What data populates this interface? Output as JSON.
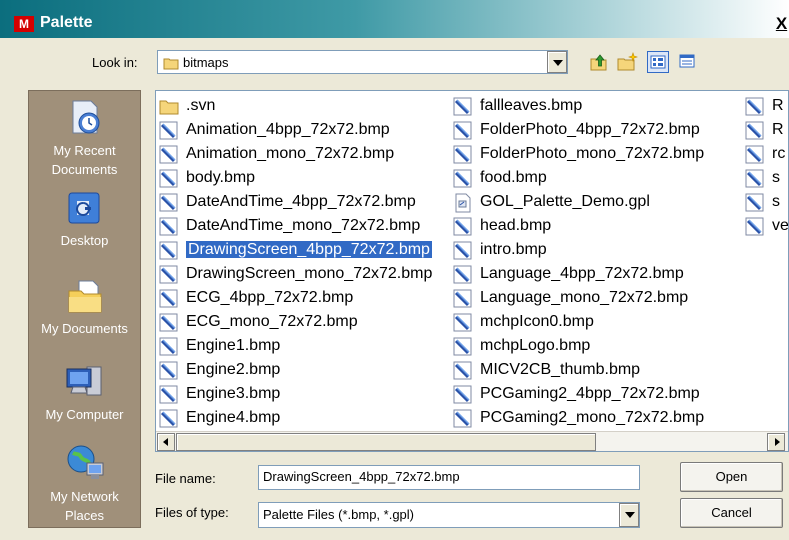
{
  "window": {
    "title": "Palette",
    "app_icon_text": "M",
    "close_label": "X"
  },
  "lookin": {
    "label": "Look in:",
    "value": "bitmaps"
  },
  "toolbar": [
    "up-folder-icon",
    "new-folder-icon",
    "view-list-icon",
    "view-details-icon"
  ],
  "places": [
    {
      "name": "my-recent-documents",
      "label": "My Recent Documents",
      "icon": "clock-doc-icon"
    },
    {
      "name": "desktop",
      "label": "Desktop",
      "icon": "desktop-icon"
    },
    {
      "name": "my-documents",
      "label": "My Documents",
      "icon": "folder-doc-icon"
    },
    {
      "name": "my-computer",
      "label": "My Computer",
      "icon": "computer-icon"
    },
    {
      "name": "my-network-places",
      "label": "My Network Places",
      "icon": "network-icon"
    }
  ],
  "files": {
    "col1": [
      {
        "name": ".svn",
        "type": "folder"
      },
      {
        "name": "Animation_4bpp_72x72.bmp",
        "type": "bmp"
      },
      {
        "name": "Animation_mono_72x72.bmp",
        "type": "bmp"
      },
      {
        "name": "body.bmp",
        "type": "bmp"
      },
      {
        "name": "DateAndTime_4bpp_72x72.bmp",
        "type": "bmp"
      },
      {
        "name": "DateAndTime_mono_72x72.bmp",
        "type": "bmp"
      },
      {
        "name": "DrawingScreen_4bpp_72x72.bmp",
        "type": "bmp",
        "selected": true
      },
      {
        "name": "DrawingScreen_mono_72x72.bmp",
        "type": "bmp"
      },
      {
        "name": "ECG_4bpp_72x72.bmp",
        "type": "bmp"
      },
      {
        "name": "ECG_mono_72x72.bmp",
        "type": "bmp"
      },
      {
        "name": "Engine1.bmp",
        "type": "bmp"
      },
      {
        "name": "Engine2.bmp",
        "type": "bmp"
      },
      {
        "name": "Engine3.bmp",
        "type": "bmp"
      },
      {
        "name": "Engine4.bmp",
        "type": "bmp"
      }
    ],
    "col2": [
      {
        "name": "fallleaves.bmp",
        "type": "bmp"
      },
      {
        "name": "FolderPhoto_4bpp_72x72.bmp",
        "type": "bmp"
      },
      {
        "name": "FolderPhoto_mono_72x72.bmp",
        "type": "bmp"
      },
      {
        "name": "food.bmp",
        "type": "bmp"
      },
      {
        "name": "GOL_Palette_Demo.gpl",
        "type": "gpl"
      },
      {
        "name": "head.bmp",
        "type": "bmp"
      },
      {
        "name": "intro.bmp",
        "type": "bmp"
      },
      {
        "name": "Language_4bpp_72x72.bmp",
        "type": "bmp"
      },
      {
        "name": "Language_mono_72x72.bmp",
        "type": "bmp"
      },
      {
        "name": "mchpIcon0.bmp",
        "type": "bmp"
      },
      {
        "name": "mchpLogo.bmp",
        "type": "bmp"
      },
      {
        "name": "MICV2CB_thumb.bmp",
        "type": "bmp"
      },
      {
        "name": "PCGaming2_4bpp_72x72.bmp",
        "type": "bmp"
      },
      {
        "name": "PCGaming2_mono_72x72.bmp",
        "type": "bmp"
      }
    ],
    "col3": [
      {
        "name": "R",
        "type": "bmp"
      },
      {
        "name": "R",
        "type": "bmp"
      },
      {
        "name": "rc",
        "type": "bmp"
      },
      {
        "name": "s",
        "type": "bmp"
      },
      {
        "name": "s",
        "type": "bmp"
      },
      {
        "name": "ve",
        "type": "bmp"
      }
    ]
  },
  "filename": {
    "label": "File name:",
    "value": "DrawingScreen_4bpp_72x72.bmp"
  },
  "filetype": {
    "label": "Files of type:",
    "value": "Palette Files (*.bmp, *.gpl)"
  },
  "buttons": {
    "open": "Open",
    "cancel": "Cancel"
  },
  "colors": {
    "title_start": "#0b6e7e",
    "selection": "#316ac5",
    "places_bg": "#a0907a"
  }
}
